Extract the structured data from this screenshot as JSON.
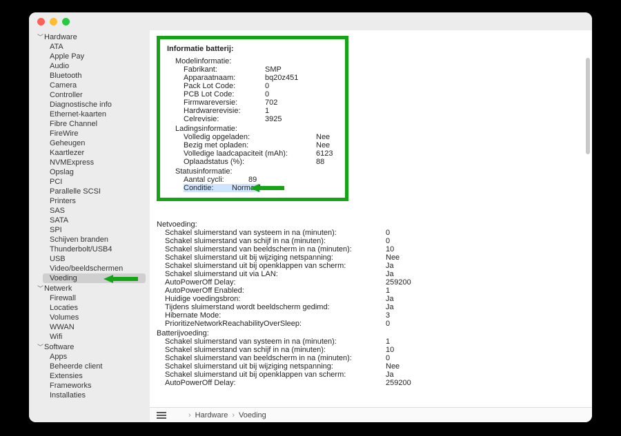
{
  "sidebar": {
    "hardware_label": "Hardware",
    "hardware_items": [
      "ATA",
      "Apple Pay",
      "Audio",
      "Bluetooth",
      "Camera",
      "Controller",
      "Diagnostische info",
      "Ethernet-kaarten",
      "Fibre Channel",
      "FireWire",
      "Geheugen",
      "Kaartlezer",
      "NVMExpress",
      "Opslag",
      "PCI",
      "Parallelle SCSI",
      "Printers",
      "SAS",
      "SATA",
      "SPI",
      "Schijven branden",
      "Thunderbolt/USB4",
      "USB",
      "Video/beeldschermen",
      "Voeding"
    ],
    "network_label": "Netwerk",
    "network_items": [
      "Firewall",
      "Locaties",
      "Volumes",
      "WWAN",
      "Wifi"
    ],
    "software_label": "Software",
    "software_items": [
      "Apps",
      "Beheerde client",
      "Extensies",
      "Frameworks",
      "Installaties"
    ]
  },
  "content": {
    "battery_info_heading": "Informatie batterij:",
    "model_section": "Modelinformatie:",
    "model": {
      "fabrikant_k": "Fabrikant:",
      "fabrikant_v": "SMP",
      "apparaat_k": "Apparaatnaam:",
      "apparaat_v": "bq20z451",
      "pack_k": "Pack Lot Code:",
      "pack_v": "0",
      "pcb_k": "PCB Lot Code:",
      "pcb_v": "0",
      "fw_k": "Firmwareversie:",
      "fw_v": "702",
      "hw_k": "Hardwarerevisie:",
      "hw_v": "1",
      "cel_k": "Celrevisie:",
      "cel_v": "3925"
    },
    "charge_section": "Ladingsinformatie:",
    "charge": {
      "full_k": "Volledig opgeladen:",
      "full_v": "Nee",
      "charging_k": "Bezig met opladen:",
      "charging_v": "Nee",
      "cap_k": "Volledige laadcapaciteit (mAh):",
      "cap_v": "6123",
      "state_k": "Oplaadstatus (%):",
      "state_v": "88"
    },
    "status_section": "Statusinformatie:",
    "status": {
      "cycles_k": "Aantal cycli:",
      "cycles_v": "89",
      "cond_k": "Conditie:",
      "cond_v": "Normaal"
    },
    "ac_section": "Netvoeding:",
    "ac": [
      {
        "k": "Schakel sluimerstand van systeem in na (minuten):",
        "v": "0"
      },
      {
        "k": "Schakel sluimerstand van schijf in na (minuten):",
        "v": "0"
      },
      {
        "k": "Schakel sluimerstand van beeldscherm in na (minuten):",
        "v": "10"
      },
      {
        "k": "Schakel sluimerstand uit bij wijziging netspanning:",
        "v": "Nee"
      },
      {
        "k": "Schakel sluimerstand uit bij openklappen van scherm:",
        "v": "Ja"
      },
      {
        "k": "Schakel sluimerstand uit via LAN:",
        "v": "Ja"
      },
      {
        "k": "AutoPowerOff Delay:",
        "v": "259200"
      },
      {
        "k": "AutoPowerOff Enabled:",
        "v": "1"
      },
      {
        "k": "Huidige voedingsbron:",
        "v": "Ja"
      },
      {
        "k": "Tijdens sluimerstand wordt beeldscherm gedimd:",
        "v": "Ja"
      },
      {
        "k": "Hibernate Mode:",
        "v": "3"
      },
      {
        "k": "PrioritizeNetworkReachabilityOverSleep:",
        "v": "0"
      }
    ],
    "batt_section": "Batterijvoeding:",
    "batt": [
      {
        "k": "Schakel sluimerstand van systeem in na (minuten):",
        "v": "1"
      },
      {
        "k": "Schakel sluimerstand van schijf in na (minuten):",
        "v": "10"
      },
      {
        "k": "Schakel sluimerstand van beeldscherm in na (minuten):",
        "v": "0"
      },
      {
        "k": "Schakel sluimerstand uit bij wijziging netspanning:",
        "v": "Nee"
      },
      {
        "k": "Schakel sluimerstand uit bij openklappen van scherm:",
        "v": "Ja"
      },
      {
        "k": "AutoPowerOff Delay:",
        "v": "259200"
      }
    ]
  },
  "pathbar": {
    "p1": "Hardware",
    "p2": "Voeding"
  }
}
